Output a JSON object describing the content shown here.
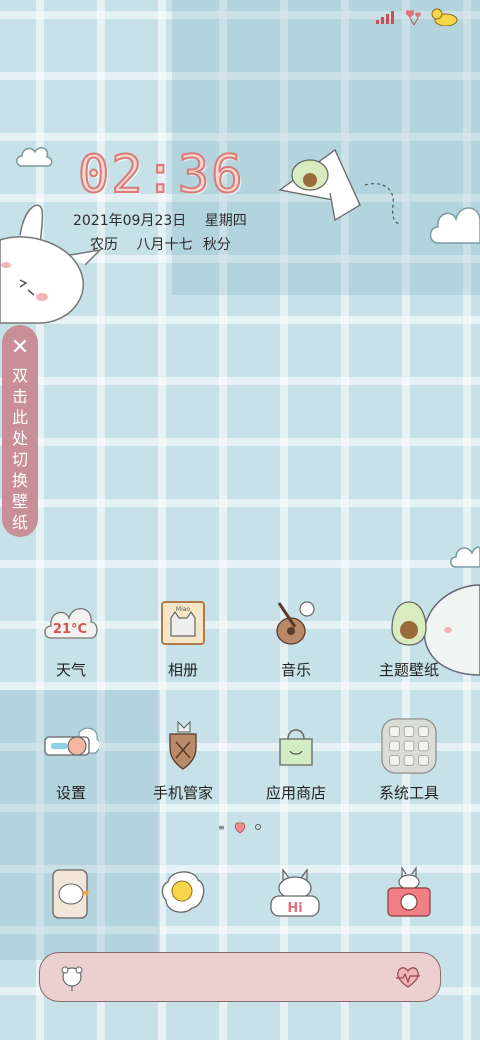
{
  "status_bar": {
    "icons": [
      "signal-icon",
      "heart-balloon-icon",
      "duck-battery-icon"
    ]
  },
  "clock": {
    "time": "02:36"
  },
  "date": {
    "gregorian": "2021年09月23日",
    "weekday": "星期四",
    "lunar_label": "农历",
    "lunar_date": "八月十七",
    "solar_term": "秋分"
  },
  "side_tip": {
    "close": "✕",
    "text": "双击此处切换壁纸"
  },
  "apps": [
    {
      "label": "天气",
      "icon": "weather-cloud-icon",
      "badge": "21°C"
    },
    {
      "label": "相册",
      "icon": "cat-frame-icon",
      "badge": "Miao"
    },
    {
      "label": "音乐",
      "icon": "guitar-bunny-icon"
    },
    {
      "label": "主题壁纸",
      "icon": "avocado-icon"
    },
    {
      "label": "设置",
      "icon": "toggle-peach-icon"
    },
    {
      "label": "手机管家",
      "icon": "cat-shield-icon"
    },
    {
      "label": "应用商店",
      "icon": "shopping-bag-icon"
    },
    {
      "label": "系统工具",
      "icon": "folder-grid-icon"
    }
  ],
  "dock": [
    {
      "icon": "duck-phone-icon"
    },
    {
      "icon": "fried-egg-icon"
    },
    {
      "icon": "bunny-hi-icon",
      "text": "Hi"
    },
    {
      "icon": "bunny-camera-icon"
    }
  ],
  "colors": {
    "background": "#c6e1e7",
    "accent_pink": "#d97a78",
    "pill": "#c98f96",
    "search": "#ecd0d0"
  }
}
